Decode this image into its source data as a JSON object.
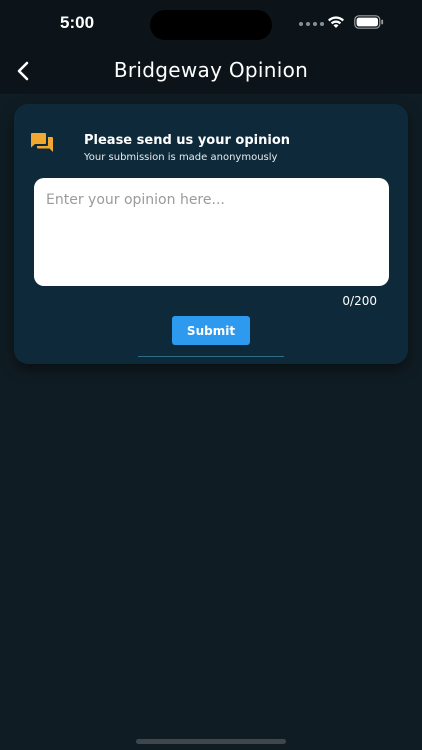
{
  "status_bar": {
    "time": "5:00",
    "wifi_icon": "wifi-icon",
    "battery_icon": "battery-icon"
  },
  "nav": {
    "back_icon": "chevron-left-icon",
    "title": "Bridgeway Opinion"
  },
  "card": {
    "icon": "chat-bubbles-icon",
    "icon_color": "#f0a830",
    "heading": "Please send us your opinion",
    "subheading": "Your submission is made anonymously",
    "input": {
      "value": "",
      "placeholder": "Enter your opinion here..."
    },
    "char_count": "0/200",
    "submit_label": "Submit"
  },
  "colors": {
    "background": "#101c23",
    "card": "#0e2a3a",
    "accent": "#2d9af0"
  }
}
